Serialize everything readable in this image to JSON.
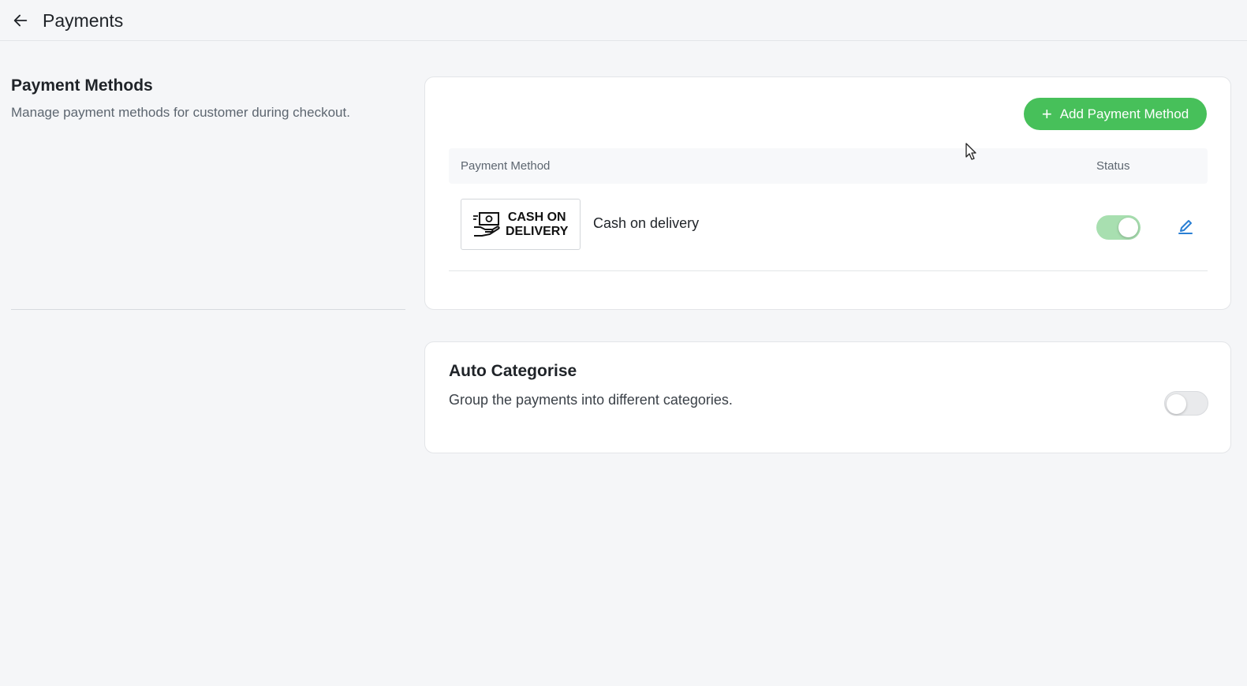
{
  "header": {
    "title": "Payments",
    "back_icon": "arrow-left-icon"
  },
  "payment_methods": {
    "title": "Payment Methods",
    "description": "Manage payment methods for customer during checkout.",
    "add_button_label": "Add Payment Method",
    "add_button_icon": "plus-icon",
    "columns": [
      "Payment Method",
      "Status"
    ],
    "rows": [
      {
        "logo_text_line1": "CASH ON",
        "logo_text_line2": "DELIVERY",
        "logo_icon": "cash-hand-icon",
        "name": "Cash on delivery",
        "status_enabled": true,
        "edit_icon": "pencil-icon"
      }
    ]
  },
  "auto_categorise": {
    "title": "Auto Categorise",
    "description": "Group the payments into different categories.",
    "enabled": false
  },
  "colors": {
    "accent_green": "#47c05a",
    "toggle_on": "#a8dfb0",
    "edit_blue": "#2a7fd4"
  }
}
